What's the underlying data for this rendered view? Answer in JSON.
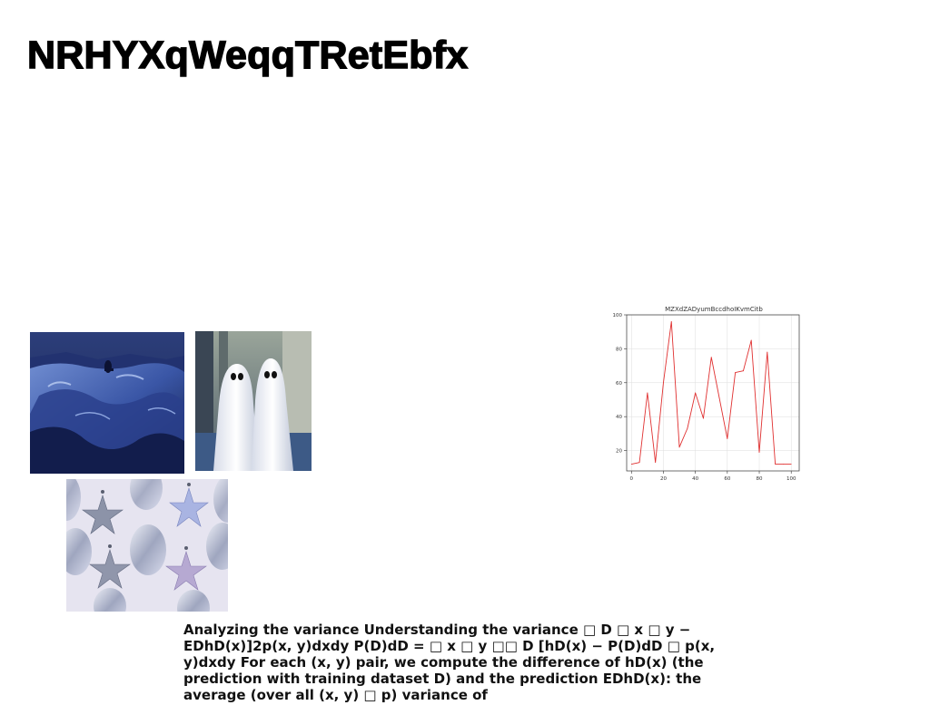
{
  "page": {
    "title": "NRHYXqWeqqTRetEbfx"
  },
  "body": {
    "text": "Analyzing the variance Understanding the variance □ D □ x □ y − EDhD(x)]2p(x, y)dxdy P(D)dD = □ x □ y □□ D [hD(x) − P(D)dD □ p(x, y)dxdy For each (x, y) pair, we compute the difference of hD(x) (the prediction with training dataset D) and the prediction EDhD(x): the average (over all (x, y) □ p) variance of"
  },
  "images": {
    "mountain": "snowy-mountain-photo",
    "ghosts": "ghost-costumes-photo",
    "stars": "star-ornaments-photo"
  },
  "chart_data": {
    "type": "line",
    "title": "MZXdZADyumBccdhoIKvmCitb",
    "xlabel": "",
    "ylabel": "",
    "xlim": [
      -3,
      105
    ],
    "ylim": [
      8,
      100
    ],
    "xticks": [
      0,
      20,
      40,
      60,
      80,
      100
    ],
    "yticks": [
      20,
      40,
      60,
      80,
      100
    ],
    "grid": true,
    "color": "#e03030",
    "x": [
      0,
      5,
      10,
      15,
      20,
      25,
      30,
      35,
      40,
      45,
      50,
      55,
      60,
      65,
      70,
      75,
      80,
      85,
      90,
      95,
      100
    ],
    "y": [
      12,
      13,
      54,
      13,
      60,
      96,
      22,
      33,
      54,
      39,
      75,
      51,
      27,
      66,
      67,
      85,
      19,
      78,
      12,
      12,
      12
    ]
  }
}
